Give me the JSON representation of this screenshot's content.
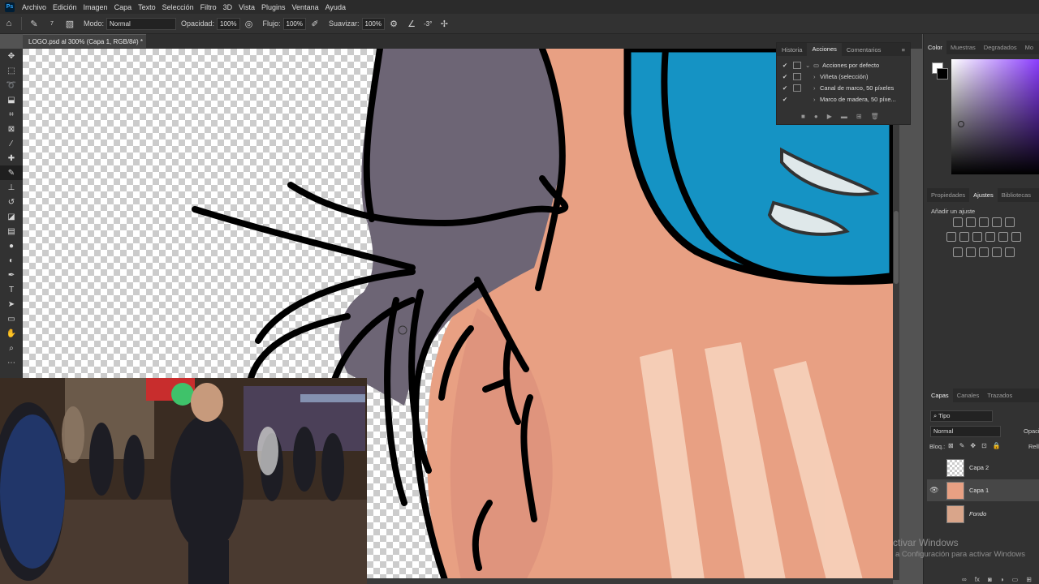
{
  "menu": {
    "logo": "Ps",
    "items": [
      "Archivo",
      "Edición",
      "Imagen",
      "Capa",
      "Texto",
      "Selección",
      "Filtro",
      "3D",
      "Vista",
      "Plugins",
      "Ventana",
      "Ayuda"
    ]
  },
  "options": {
    "brush_size": "7",
    "mode_label": "Modo:",
    "mode_value": "Normal",
    "opacity_label": "Opacidad:",
    "opacity_value": "100%",
    "flow_label": "Flujo:",
    "flow_value": "100%",
    "smooth_label": "Suavizar:",
    "smooth_value": "100%",
    "angle_value": "-3°"
  },
  "document": {
    "tab_title": "LOGO.psd al 300% (Capa 1, RGB/8#) *"
  },
  "actions_panel": {
    "tabs": [
      "Historia",
      "Acciones",
      "Comentarios"
    ],
    "active_tab": "Acciones",
    "rows": [
      {
        "label": "Acciones por defecto",
        "checked": "✔",
        "folder": true
      },
      {
        "label": "Viñeta (selección)",
        "checked": "✔",
        "folder": false
      },
      {
        "label": "Canal de marco, 50 píxeles",
        "checked": "✔",
        "folder": false
      },
      {
        "label": "Marco de madera, 50 píxe...",
        "checked": "✔",
        "folder": false
      }
    ]
  },
  "color_panel": {
    "tabs": [
      "Color",
      "Muestras",
      "Degradados",
      "Mo"
    ],
    "hue": "#8b3dff"
  },
  "adjust_panel": {
    "tabs": [
      "Propiedades",
      "Ajustes",
      "Bibliotecas"
    ],
    "title": "Añadir un ajuste"
  },
  "layers_panel": {
    "tabs": [
      "Capas",
      "Canales",
      "Trazados"
    ],
    "filter_value": "Tipo",
    "blend_value": "Normal",
    "opacity_label": "Opaci",
    "lock_label": "Bloq.:",
    "fill_label": "Rell",
    "layers": [
      {
        "name": "Capa 2",
        "visible": ""
      },
      {
        "name": "Capa 1",
        "visible": "👁"
      },
      {
        "name": "Fondo",
        "visible": ""
      }
    ]
  },
  "watermark": {
    "line1": "ctivar Windows",
    "line2": "a Configuración para activar Windows"
  },
  "colors": {
    "skin": "#e8a083",
    "skin_shadow": "#d98c7a",
    "hair": "#6d6575",
    "visor": "#1593c4",
    "highlight": "#f8d5c0"
  }
}
